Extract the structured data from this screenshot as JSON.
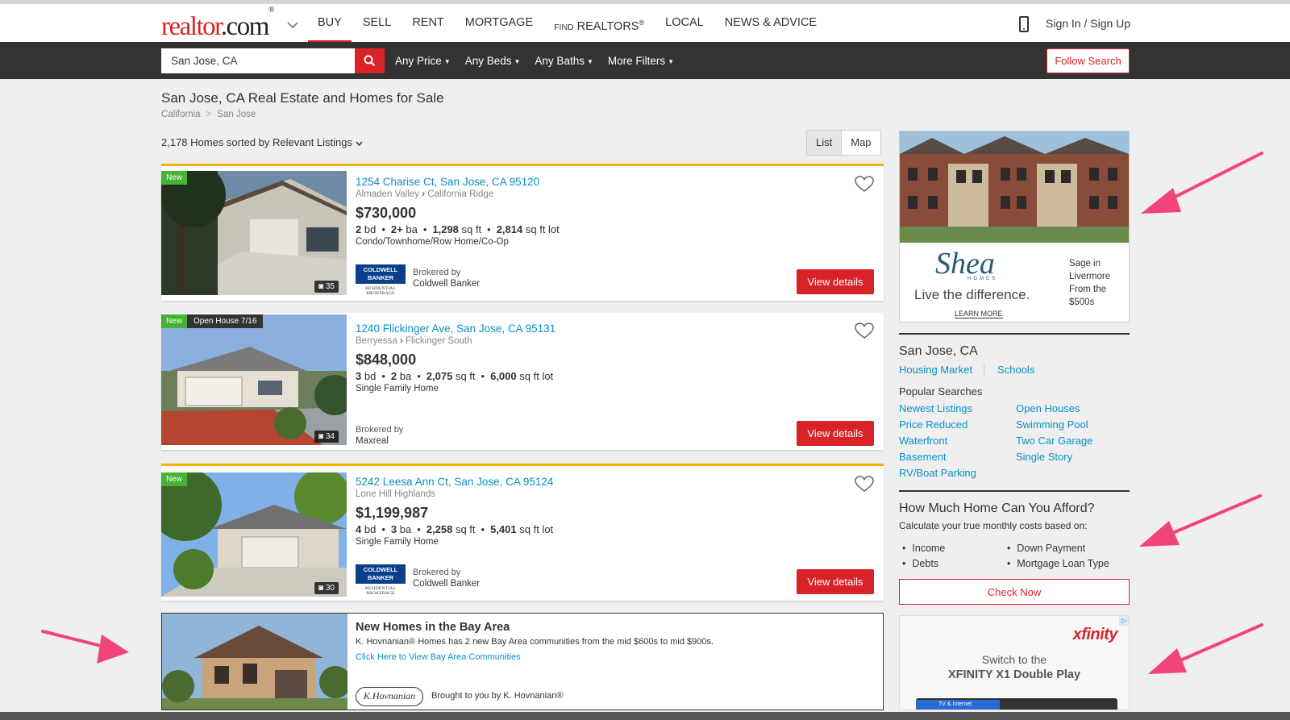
{
  "header": {
    "logo_main": "realtor",
    "logo_dot_com": ".com",
    "logo_mark": "®",
    "nav": [
      {
        "label": "BUY"
      },
      {
        "label": "SELL"
      },
      {
        "label": "RENT"
      },
      {
        "label": "MORTGAGE"
      },
      {
        "label_prefix": "FIND",
        "label": "REALTORS",
        "mark": "®"
      },
      {
        "label": "LOCAL"
      },
      {
        "label": "NEWS & ADVICE"
      }
    ],
    "signin": "Sign In / Sign Up"
  },
  "search": {
    "value": "San Jose, CA",
    "filters": [
      "Any Price",
      "Any Beds",
      "Any Baths",
      "More Filters"
    ],
    "follow": "Follow Search"
  },
  "page": {
    "title": "San Jose, CA Real Estate and Homes for Sale",
    "breadcrumb": [
      "California",
      "San Jose"
    ],
    "sort_text": "2,178 Homes sorted by Relevant Listings",
    "view_list": "List",
    "view_map": "Map"
  },
  "listings": [
    {
      "badge_new": "New",
      "address": "1254 Charise Ct, San Jose, CA 95120",
      "area": "Almaden Valley",
      "subarea": "California Ridge",
      "price": "$730,000",
      "beds": "2",
      "beds_unit": "bd",
      "baths": "2+",
      "baths_unit": "ba",
      "sqft": "1,298",
      "sqft_unit": "sq ft",
      "lot": "2,814",
      "lot_unit": "sq ft lot",
      "type": "Condo/Townhome/Row Home/Co-Op",
      "photos": "35",
      "broker_logo_line1": "COLDWELL",
      "broker_logo_line2": "BANKER",
      "broker_logo_sub": "RESIDENTIAL BROKERAGE",
      "brokered_by": "Brokered by",
      "broker": "Coldwell Banker",
      "cta": "View details"
    },
    {
      "badge_new": "New",
      "badge_open": "Open House 7/16",
      "address": "1240 Flickinger Ave, San Jose, CA 95131",
      "area": "Berryessa",
      "subarea": "Flickinger South",
      "price": "$848,000",
      "beds": "3",
      "beds_unit": "bd",
      "baths": "2",
      "baths_unit": "ba",
      "sqft": "2,075",
      "sqft_unit": "sq ft",
      "lot": "6,000",
      "lot_unit": "sq ft lot",
      "type": "Single Family Home",
      "photos": "34",
      "brokered_by": "Brokered by",
      "broker": "Maxreal",
      "cta": "View details"
    },
    {
      "badge_new": "New",
      "address": "5242 Leesa Ann Ct, San Jose, CA 95124",
      "area": "Lone Hill Highlands",
      "price": "$1,199,987",
      "beds": "4",
      "beds_unit": "bd",
      "baths": "3",
      "baths_unit": "ba",
      "sqft": "2,258",
      "sqft_unit": "sq ft",
      "lot": "5,401",
      "lot_unit": "sq ft lot",
      "type": "Single Family Home",
      "photos": "30",
      "broker_logo_line1": "COLDWELL",
      "broker_logo_line2": "BANKER",
      "broker_logo_sub": "RESIDENTIAL BROKERAGE",
      "brokered_by": "Brokered by",
      "broker": "Coldwell Banker",
      "cta": "View details"
    }
  ],
  "ad_listing": {
    "title": "New Homes in the Bay Area",
    "desc": "K. Hovnanian® Homes has 2 new Bay Area communities from the mid $600s to mid $900s.",
    "link": "Click Here to View Bay Area Communities",
    "logo": "K.Hovnanian",
    "brought": "Brought to you by K. Hovnanian®"
  },
  "sidebar": {
    "shea": {
      "logo": "Shea",
      "homes": "HOMES",
      "tagline": "Live the difference.",
      "learn": "LEARN MORE",
      "side_text": "Sage in Livermore From the $500s"
    },
    "city": "San Jose, CA",
    "city_link1": "Housing Market",
    "city_link2": "Schools",
    "popular_heading": "Popular Searches",
    "popular": [
      "Newest Listings",
      "Open Houses",
      "Price Reduced",
      "Swimming Pool",
      "Waterfront",
      "Two Car Garage",
      "Basement",
      "Single Story",
      "RV/Boat Parking"
    ],
    "afford_heading": "How Much Home Can You Afford?",
    "afford_sub": "Calculate your true monthly costs based on:",
    "afford_items": [
      "Income",
      "Down Payment",
      "Debts",
      "Mortgage Loan Type"
    ],
    "check": "Check Now",
    "xfinity": {
      "logo": "xfinity",
      "line1": "Switch to the",
      "line2": "XFINITY X1 Double Play",
      "tag": "TV & Internet"
    }
  },
  "colors": {
    "brand_red": "#d92228",
    "link_blue": "#0a8fc6",
    "badge_green": "#44b332",
    "featured_gold": "#f5b400",
    "arrow_pink": "#f0447a"
  }
}
